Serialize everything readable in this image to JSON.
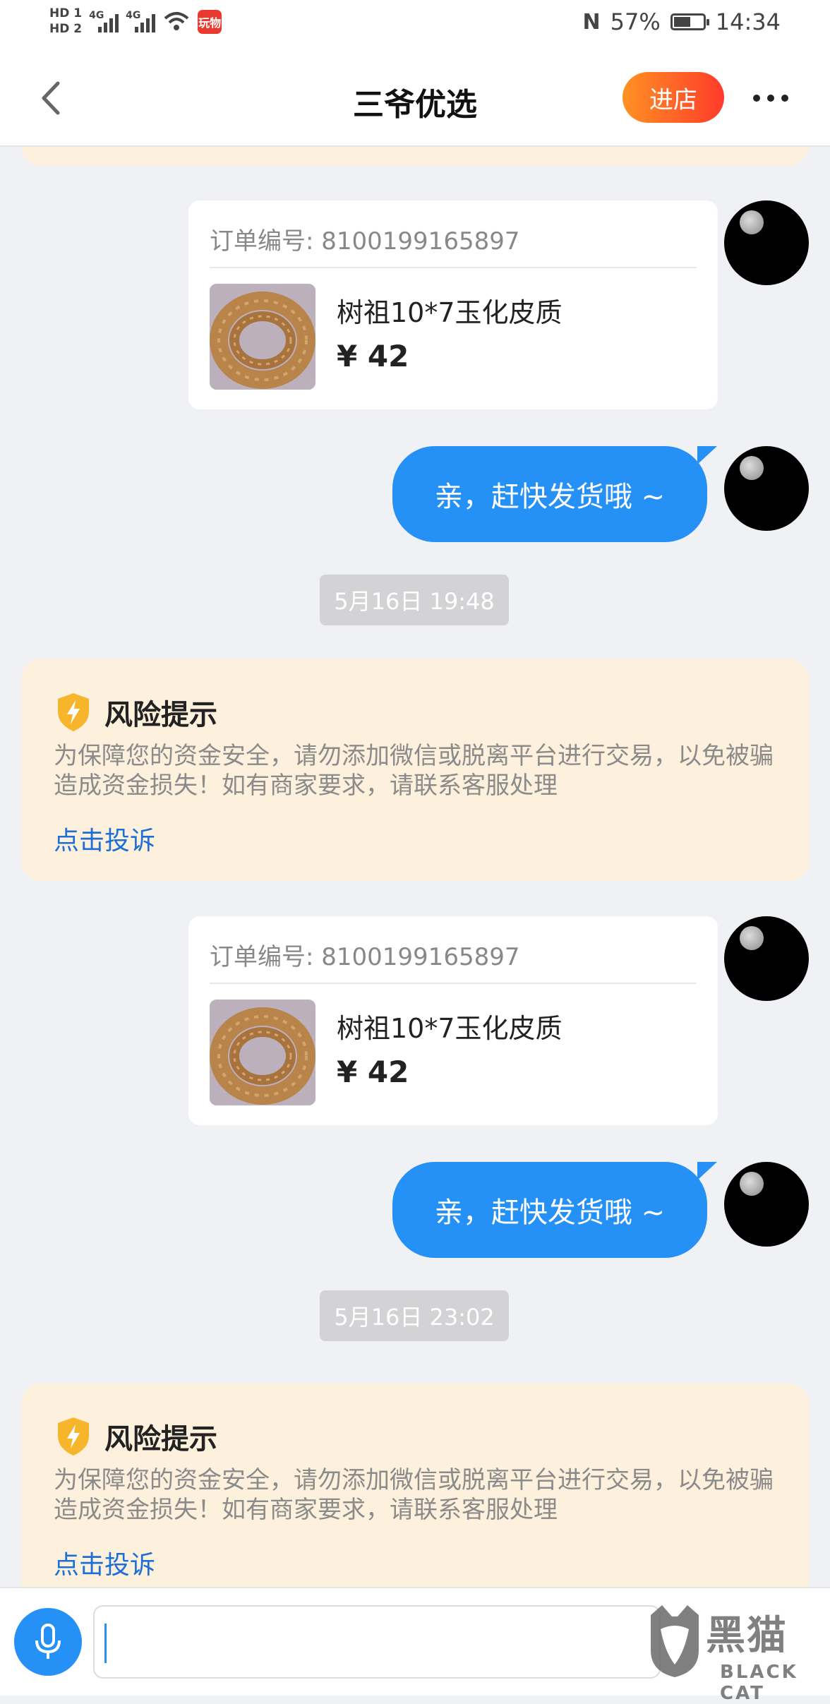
{
  "status_bar": {
    "hd1": "HD 1",
    "hd2": "HD 2",
    "net1": "4G",
    "net2": "4G",
    "app_badge": "玩物",
    "battery_percent": "57%",
    "battery_level": 0.57,
    "time": "14:34"
  },
  "header": {
    "title": "三爷优选",
    "enter_store_label": "进店"
  },
  "messages": {
    "order_card_1": {
      "order_number": "订单编号: 8100199165897",
      "product_name": "树祖10*7玉化皮质",
      "price": "¥ 42"
    },
    "bubble_1": "亲，赶快发货哦 ~",
    "timestamp_1": "5月16日 19:48",
    "risk_1": {
      "title": "风险提示",
      "text": "为保障您的资金安全，请勿添加微信或脱离平台进行交易，以免被骗造成资金损失！如有商家要求，请联系客服处理",
      "link": "点击投诉"
    },
    "order_card_2": {
      "order_number": "订单编号: 8100199165897",
      "product_name": "树祖10*7玉化皮质",
      "price": "¥ 42"
    },
    "bubble_2": "亲，赶快发货哦 ~",
    "timestamp_2": "5月16日 23:02",
    "risk_2": {
      "title": "风险提示",
      "text": "为保障您的资金安全，请勿添加微信或脱离平台进行交易，以免被骗造成资金损失！如有商家要求，请联系客服处理",
      "link": "点击投诉"
    }
  },
  "input": {
    "value": ""
  },
  "watermark": {
    "chinese": "黑猫",
    "english": "BLACK CAT"
  },
  "icons": {
    "back": "chevron-left-icon",
    "more": "more-dots-icon",
    "voice": "microphone-icon",
    "risk": "shield-lightning-icon"
  },
  "colors": {
    "accent_blue": "#2590f5",
    "store_button_start": "#ff9124",
    "store_button_end": "#ff3b2a",
    "risk_background": "#fdf0dc",
    "link_blue": "#1d6fd8",
    "shield_yellow": "#f7b52c"
  }
}
